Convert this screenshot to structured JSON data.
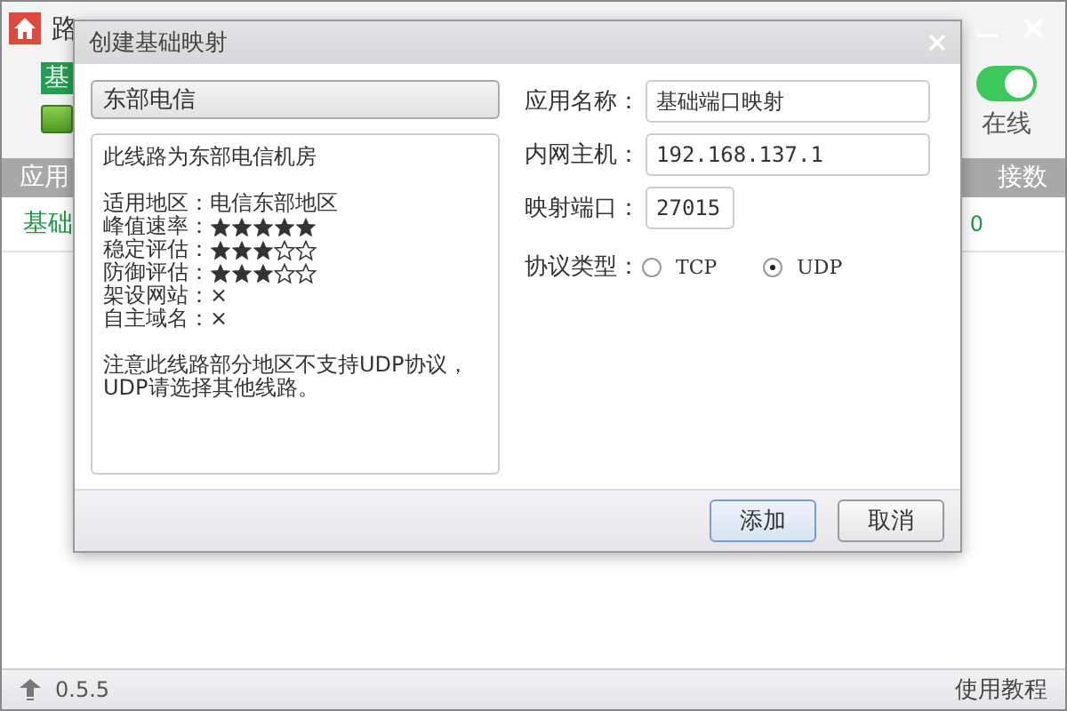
{
  "main_window": {
    "title": "路",
    "mode_label": "基",
    "online_toggle": {
      "on": true
    },
    "online_label": "在线",
    "table": {
      "columns": [
        "应用",
        "接数"
      ],
      "rows": [
        {
          "name": "基础",
          "connections": "0"
        }
      ]
    },
    "status_bar": {
      "version": "0.5.5",
      "help_link": "使用教程"
    }
  },
  "dialog": {
    "title": "创建基础映射",
    "line_select": "东部电信",
    "description": {
      "intro": "此线路为东部电信机房",
      "specs": [
        {
          "kind": "text",
          "label": "适用地区：",
          "value": "电信东部地区"
        },
        {
          "kind": "stars",
          "label": "峰值速率：",
          "stars": 5
        },
        {
          "kind": "stars",
          "label": "稳定评估：",
          "stars": 3
        },
        {
          "kind": "stars",
          "label": "防御评估：",
          "stars": 3
        },
        {
          "kind": "text",
          "label": "架设网站：",
          "value": "×"
        },
        {
          "kind": "text",
          "label": "自主域名：",
          "value": "×"
        }
      ],
      "note": "注意此线路部分地区不支持UDP协议，UDP请选择其他线路。"
    },
    "fields": [
      {
        "label": "应用名称：",
        "value": "基础端口映射"
      },
      {
        "label": "内网主机：",
        "value": "192.168.137.1"
      },
      {
        "label": "映射端口：",
        "value": "27015"
      }
    ],
    "protocol": {
      "label": "协议类型：",
      "options": [
        {
          "label": "TCP",
          "selected": false
        },
        {
          "label": "UDP",
          "selected": true
        }
      ]
    },
    "buttons": [
      {
        "label": "添加",
        "primary": true
      },
      {
        "label": "取消",
        "primary": false
      }
    ]
  }
}
